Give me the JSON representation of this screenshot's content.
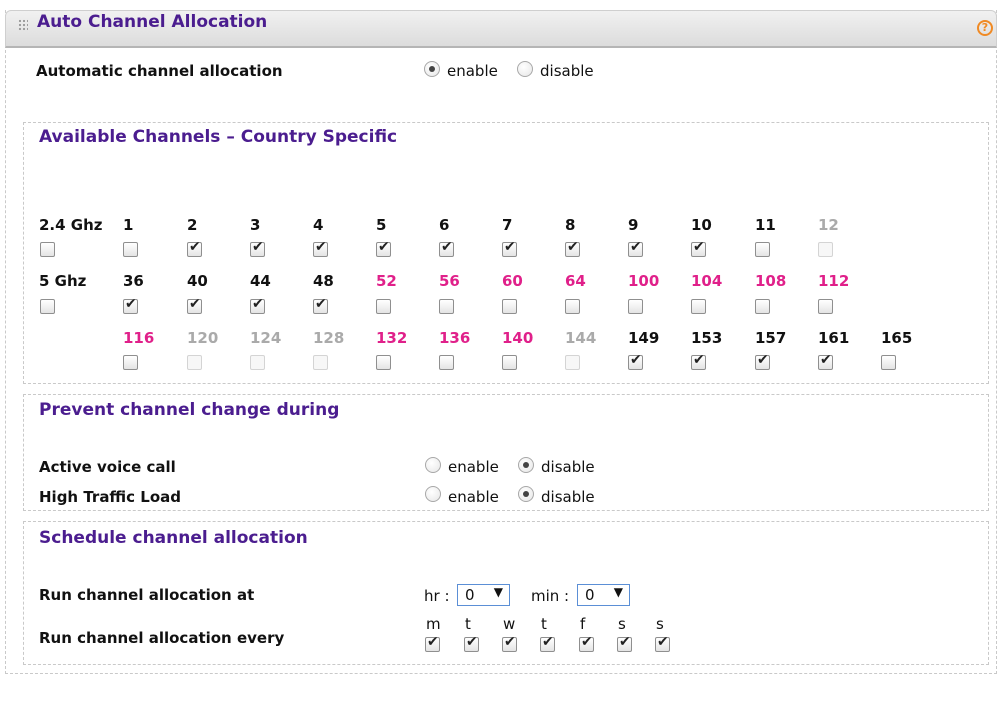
{
  "header": {
    "title": "Auto Channel Allocation",
    "help_icon": "help-circle-icon",
    "help_glyph": "?"
  },
  "auto_alloc": {
    "label": "Automatic channel allocation",
    "enable_label": "enable",
    "disable_label": "disable",
    "selected": "enable"
  },
  "channels": {
    "title": "Available Channels – Country Specific",
    "band_24": "2.4 Ghz",
    "band_5": "5 Ghz",
    "row_24": [
      {
        "n": "1",
        "state": "enabled",
        "checked": false
      },
      {
        "n": "2",
        "state": "enabled",
        "checked": true
      },
      {
        "n": "3",
        "state": "enabled",
        "checked": true
      },
      {
        "n": "4",
        "state": "enabled",
        "checked": true
      },
      {
        "n": "5",
        "state": "enabled",
        "checked": true
      },
      {
        "n": "6",
        "state": "enabled",
        "checked": true
      },
      {
        "n": "7",
        "state": "enabled",
        "checked": true
      },
      {
        "n": "8",
        "state": "enabled",
        "checked": true
      },
      {
        "n": "9",
        "state": "enabled",
        "checked": true
      },
      {
        "n": "10",
        "state": "enabled",
        "checked": true
      },
      {
        "n": "11",
        "state": "enabled",
        "checked": false
      },
      {
        "n": "12",
        "state": "disabled",
        "checked": false
      }
    ],
    "row_5a": [
      {
        "n": "36",
        "state": "enabled",
        "checked": true
      },
      {
        "n": "40",
        "state": "enabled",
        "checked": true
      },
      {
        "n": "44",
        "state": "enabled",
        "checked": true
      },
      {
        "n": "48",
        "state": "enabled",
        "checked": true
      },
      {
        "n": "52",
        "state": "dfs",
        "checked": false
      },
      {
        "n": "56",
        "state": "dfs",
        "checked": false
      },
      {
        "n": "60",
        "state": "dfs",
        "checked": false
      },
      {
        "n": "64",
        "state": "dfs",
        "checked": false
      },
      {
        "n": "100",
        "state": "dfs",
        "checked": false
      },
      {
        "n": "104",
        "state": "dfs",
        "checked": false
      },
      {
        "n": "108",
        "state": "dfs",
        "checked": false
      },
      {
        "n": "112",
        "state": "dfs",
        "checked": false
      }
    ],
    "row_5b": [
      {
        "n": "116",
        "state": "dfs",
        "checked": false
      },
      {
        "n": "120",
        "state": "disabled",
        "checked": false
      },
      {
        "n": "124",
        "state": "disabled",
        "checked": false
      },
      {
        "n": "128",
        "state": "disabled",
        "checked": false
      },
      {
        "n": "132",
        "state": "dfs",
        "checked": false
      },
      {
        "n": "136",
        "state": "dfs",
        "checked": false
      },
      {
        "n": "140",
        "state": "dfs",
        "checked": false
      },
      {
        "n": "144",
        "state": "disabled",
        "checked": false
      },
      {
        "n": "149",
        "state": "enabled",
        "checked": true
      },
      {
        "n": "153",
        "state": "enabled",
        "checked": true
      },
      {
        "n": "157",
        "state": "enabled",
        "checked": true
      },
      {
        "n": "161",
        "state": "enabled",
        "checked": true
      },
      {
        "n": "165",
        "state": "enabled",
        "checked": false
      }
    ],
    "colors": {
      "enabled": "#111111",
      "dfs": "#e0208a",
      "disabled": "#aaaaaa"
    }
  },
  "prevent": {
    "title": "Prevent channel change during",
    "voice": {
      "label": "Active voice call",
      "enable_label": "enable",
      "disable_label": "disable",
      "selected": "disable"
    },
    "traffic": {
      "label": "High Traffic Load",
      "enable_label": "enable",
      "disable_label": "disable",
      "selected": "disable"
    }
  },
  "schedule": {
    "title": "Schedule channel allocation",
    "run_at_label": "Run channel allocation at",
    "hr_label": "hr :",
    "hr_value": "0",
    "min_label": "min :",
    "min_value": "0",
    "run_every_label": "Run channel allocation every",
    "days": [
      {
        "d": "m",
        "checked": true
      },
      {
        "d": "t",
        "checked": true
      },
      {
        "d": "w",
        "checked": true
      },
      {
        "d": "t",
        "checked": true
      },
      {
        "d": "f",
        "checked": true
      },
      {
        "d": "s",
        "checked": true
      },
      {
        "d": "s",
        "checked": true
      }
    ]
  },
  "accent_color": "#4b1d8f"
}
